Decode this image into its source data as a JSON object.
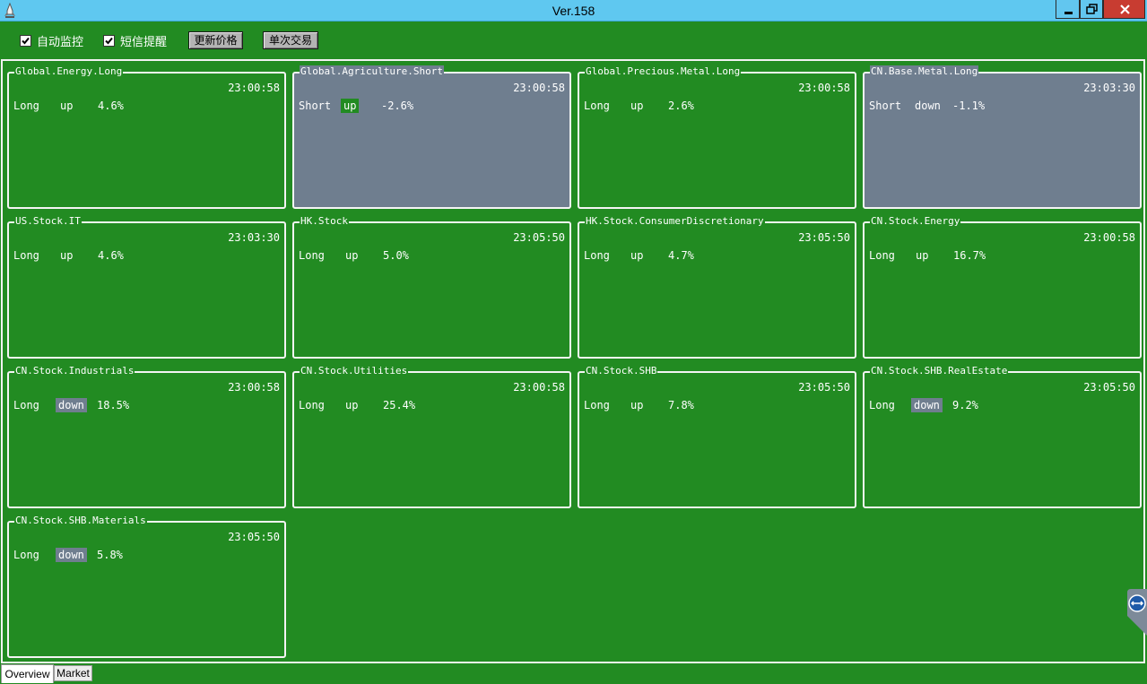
{
  "window": {
    "title": "Ver.158",
    "icon": "rocket-icon",
    "controls": [
      "minimize-icon",
      "restore-icon",
      "close-icon"
    ],
    "colors": {
      "titlebar": "#5fc8f0",
      "close": "#c83c31"
    }
  },
  "toolbar": {
    "auto_monitor": {
      "label": "自动监控",
      "checked": true
    },
    "sms_alert": {
      "label": "短信提醒",
      "checked": true
    },
    "update_price_label": "更新价格",
    "single_trade_label": "单次交易"
  },
  "colors": {
    "panel_green": "#228b22",
    "card_gray": "#6f7e8f",
    "border": "#f4f4f4"
  },
  "cards": [
    {
      "title": "Global.Energy.Long",
      "time": "23:00:58",
      "position": "Long",
      "direction": "up",
      "change": "4.6%",
      "bg": "green",
      "dir_highlight": "none"
    },
    {
      "title": "Global.Agriculture.Short",
      "time": "23:00:58",
      "position": "Short",
      "direction": "up",
      "change": "-2.6%",
      "bg": "gray",
      "dir_highlight": "green"
    },
    {
      "title": "Global.Precious.Metal.Long",
      "time": "23:00:58",
      "position": "Long",
      "direction": "up",
      "change": "2.6%",
      "bg": "green",
      "dir_highlight": "none"
    },
    {
      "title": "CN.Base.Metal.Long",
      "time": "23:03:30",
      "position": "Short",
      "direction": "down",
      "change": "-1.1%",
      "bg": "gray",
      "dir_highlight": "none"
    },
    {
      "title": "US.Stock.IT",
      "time": "23:03:30",
      "position": "Long",
      "direction": "up",
      "change": "4.6%",
      "bg": "green",
      "dir_highlight": "none"
    },
    {
      "title": "HK.Stock",
      "time": "23:05:50",
      "position": "Long",
      "direction": "up",
      "change": "5.0%",
      "bg": "green",
      "dir_highlight": "none"
    },
    {
      "title": "HK.Stock.ConsumerDiscretionary",
      "time": "23:05:50",
      "position": "Long",
      "direction": "up",
      "change": "4.7%",
      "bg": "green",
      "dir_highlight": "none"
    },
    {
      "title": "CN.Stock.Energy",
      "time": "23:00:58",
      "position": "Long",
      "direction": "up",
      "change": "16.7%",
      "bg": "green",
      "dir_highlight": "none"
    },
    {
      "title": "CN.Stock.Industrials",
      "time": "23:00:58",
      "position": "Long",
      "direction": "down",
      "change": "18.5%",
      "bg": "green",
      "dir_highlight": "gray"
    },
    {
      "title": "CN.Stock.Utilities",
      "time": "23:00:58",
      "position": "Long",
      "direction": "up",
      "change": "25.4%",
      "bg": "green",
      "dir_highlight": "none"
    },
    {
      "title": "CN.Stock.SHB",
      "time": "23:05:50",
      "position": "Long",
      "direction": "up",
      "change": "7.8%",
      "bg": "green",
      "dir_highlight": "none"
    },
    {
      "title": "CN.Stock.SHB.RealEstate",
      "time": "23:05:50",
      "position": "Long",
      "direction": "down",
      "change": "9.2%",
      "bg": "green",
      "dir_highlight": "gray"
    },
    {
      "title": "CN.Stock.SHB.Materials",
      "time": "23:05:50",
      "position": "Long",
      "direction": "down",
      "change": "5.8%",
      "bg": "green",
      "dir_highlight": "gray"
    }
  ],
  "tabs": [
    {
      "label": "Overview",
      "active": true
    },
    {
      "label": "Market",
      "active": false
    }
  ],
  "side_handle": {
    "icon": "remote-control-icon"
  }
}
